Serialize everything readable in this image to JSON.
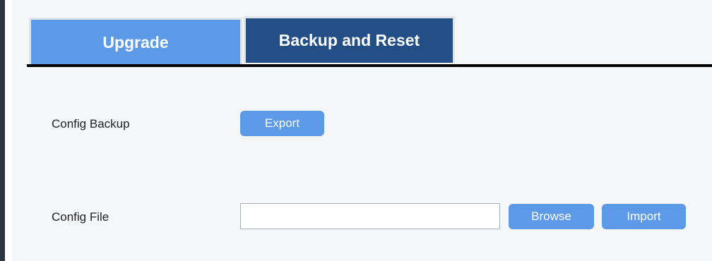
{
  "tabs": [
    {
      "label": "Upgrade",
      "active": false
    },
    {
      "label": "Backup and Reset",
      "active": true
    }
  ],
  "config_backup": {
    "label": "Config Backup",
    "export_label": "Export"
  },
  "config_file": {
    "label": "Config File",
    "input_value": "",
    "browse_label": "Browse",
    "import_label": "Import"
  },
  "colors": {
    "tab_inactive": "#5c9ae8",
    "tab_active": "#234f86",
    "button": "#5c9ae8",
    "left_border": "#2f3540",
    "content_background": "#f5f6f7"
  }
}
